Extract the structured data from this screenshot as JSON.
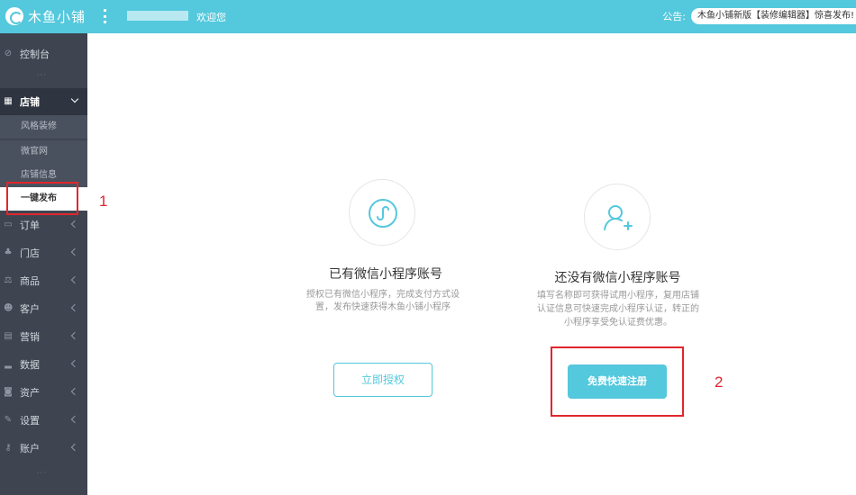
{
  "header": {
    "logo_text": "木鱼小铺",
    "welcome": "欢迎您",
    "notice_label": "公告:",
    "notice_text": "木鱼小铺新版【装修编辑器】惊喜发布!"
  },
  "sidebar": {
    "items": [
      {
        "label": "控制台",
        "icon": "dashboard-icon"
      },
      {
        "label": "店铺",
        "icon": "store-icon",
        "expanded": true
      },
      {
        "label": "订单",
        "icon": "order-icon"
      },
      {
        "label": "门店",
        "icon": "branch-icon"
      },
      {
        "label": "商品",
        "icon": "goods-icon"
      },
      {
        "label": "客户",
        "icon": "customer-icon"
      },
      {
        "label": "营销",
        "icon": "marketing-icon"
      },
      {
        "label": "数据",
        "icon": "data-icon"
      },
      {
        "label": "资产",
        "icon": "asset-icon"
      },
      {
        "label": "设置",
        "icon": "settings-icon"
      },
      {
        "label": "账户",
        "icon": "account-icon"
      }
    ],
    "sub_items": [
      "风格装修",
      "微官网",
      "店铺信息",
      "一键发布"
    ],
    "more_dots": "···"
  },
  "main": {
    "left_card": {
      "title": "已有微信小程序账号",
      "desc_line1": "授权已有微信小程序，完成支付方式设",
      "desc_line2": "置，发布快速获得木鱼小铺小程序",
      "button": "立即授权",
      "icon": "mini-program-icon"
    },
    "right_card": {
      "title": "还没有微信小程序账号",
      "desc_line1": "填写名称即可获得试用小程序，复用店铺",
      "desc_line2": "认证信息可快速完成小程序认证，转正的",
      "desc_line3": "小程序享受免认证费优惠。",
      "button": "免费快速注册",
      "icon": "add-user-icon"
    }
  },
  "annotations": {
    "one": "1",
    "two": "2"
  },
  "colors": {
    "accent": "#54c8dc",
    "sidebar": "#3e4551",
    "annotation": "#e1262d"
  }
}
